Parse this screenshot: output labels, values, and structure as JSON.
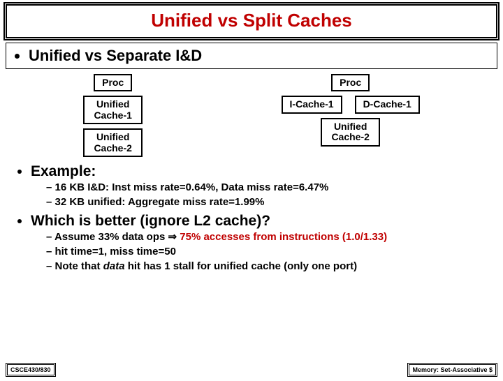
{
  "title": "Unified vs Split Caches",
  "bullet1": "Unified vs Separate I&D",
  "diagram": {
    "left": {
      "proc": "Proc",
      "l1": "Unified\nCache-1",
      "l2": "Unified\nCache-2"
    },
    "right": {
      "proc": "Proc",
      "icache": "I-Cache-1",
      "dcache": "D-Cache-1",
      "l2": "Unified\nCache-2"
    }
  },
  "example_label": "Example:",
  "example_items": [
    "16 KB I&D: Inst miss rate=0.64%, Data miss rate=6.47%",
    "32 KB unified: Aggregate miss rate=1.99%"
  ],
  "which_label": "Which is better (ignore L2 cache)?",
  "which_items": {
    "a_pre": "Assume 33% data ops ",
    "a_arrow": "⇒",
    "a_post": " 75% accesses from instructions (1.0/1.33)",
    "b": "hit time=1, miss time=50",
    "c_pre": "Note that ",
    "c_italic": "data",
    "c_post": " hit has 1 stall for unified cache (only one port)"
  },
  "footer": {
    "left": "CSCE430/830",
    "right": "Memory: Set-Associative $"
  }
}
